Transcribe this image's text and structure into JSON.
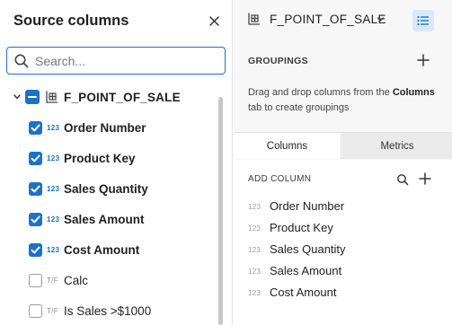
{
  "source_panel": {
    "title": "Source columns",
    "search": {
      "placeholder": "Search...",
      "value": ""
    },
    "tree": {
      "table_name": "F_POINT_OF_SALE",
      "columns": [
        {
          "label": "Order Number",
          "type": "123",
          "checked": true
        },
        {
          "label": "Product Key",
          "type": "123",
          "checked": true
        },
        {
          "label": "Sales Quantity",
          "type": "123",
          "checked": true
        },
        {
          "label": "Sales Amount",
          "type": "123",
          "checked": true
        },
        {
          "label": "Cost Amount",
          "type": "123",
          "checked": true
        },
        {
          "label": "Calc",
          "type": "T/F",
          "checked": false
        },
        {
          "label": "Is Sales >$1000",
          "type": "T/F",
          "checked": false
        }
      ]
    }
  },
  "config_panel": {
    "table_name": "F_POINT_OF_SALE",
    "groupings": {
      "header": "GROUPINGS",
      "hint_prefix": "Drag and drop columns from the",
      "hint_bold": "Columns",
      "hint_suffix": "tab to create groupings"
    },
    "tabs": [
      {
        "label": "Columns",
        "active": true
      },
      {
        "label": "Metrics",
        "active": false
      }
    ],
    "add_column_header": "ADD COLUMN",
    "selected_columns": [
      {
        "label": "Order Number",
        "type": "123"
      },
      {
        "label": "Product Key",
        "type": "123"
      },
      {
        "label": "Sales Quantity",
        "type": "123"
      },
      {
        "label": "Sales Amount",
        "type": "123"
      },
      {
        "label": "Cost Amount",
        "type": "123"
      }
    ]
  },
  "colors": {
    "accent": "#1b72c6",
    "accent_soft": "#dbe8f8",
    "panel_bg": "#f7f7f7"
  },
  "icons": [
    "close-icon",
    "search-icon",
    "chevron-down-icon",
    "table-icon",
    "list-icon",
    "plus-icon"
  ]
}
